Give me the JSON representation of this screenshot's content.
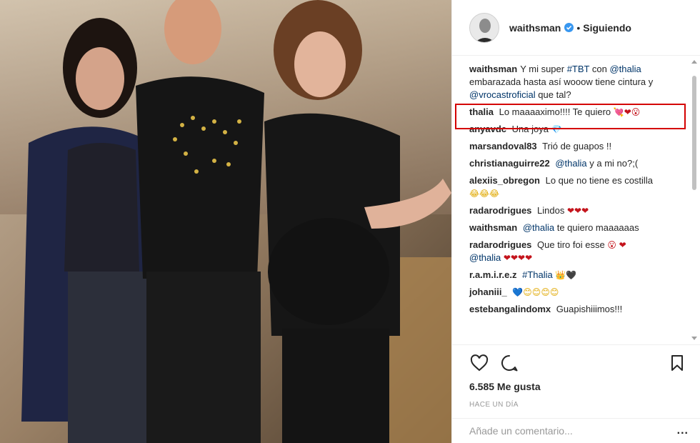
{
  "post": {
    "image_alt": "Photo of three people posing together",
    "author": "waithsman",
    "follow_status": "Siguiendo",
    "separator": "•"
  },
  "caption": {
    "user": "waithsman",
    "t1": "Y mi super ",
    "tag": "#TBT",
    "t2": " con ",
    "m1": "@thalia",
    "t3": " embarazada hasta así wooow tiene cintura y ",
    "m2": "@vrocastroficial",
    "t4": " que tal?"
  },
  "comments": [
    {
      "user": "thalia",
      "text": "Lo maaaaximo!!!! Te quiero",
      "emoji": "💘❤😮"
    },
    {
      "user": "anyavdc",
      "text": "Una joya",
      "emoji": "💎"
    },
    {
      "user": "marsandoval83",
      "text": "Trió de guapos !!",
      "emoji": ""
    },
    {
      "user": "christianaguirre22",
      "mention": "@thalia",
      "text": " y a mi no?;(",
      "emoji": ""
    },
    {
      "user": "alexiis_obregon",
      "text": "Lo que no tiene es costilla",
      "emoji": "😂😂😂"
    },
    {
      "user": "radarodrigues",
      "text": "Lindos",
      "emoji": "❤❤❤"
    },
    {
      "user": "waithsman",
      "mention": "@thalia",
      "text": " te quiero maaaaaas",
      "emoji": ""
    },
    {
      "user": "radarodrigues",
      "text": "Que tiro foi esse",
      "emoji": "😮 ❤",
      "mention2": "@thalia",
      "emoji2": "❤❤❤❤"
    },
    {
      "user": "r.a.m.i.r.e.z",
      "tag": "#Thalia",
      "emoji": "👑🖤"
    },
    {
      "user": "johaniii_",
      "emoji": "💙😊😊😊😊"
    },
    {
      "user": "estebangalindomx",
      "text": "Guapishiiimos!!!",
      "emoji": ""
    }
  ],
  "actions": {
    "like_icon": "heart-outline-icon",
    "comment_icon": "comment-bubble-icon",
    "save_icon": "bookmark-icon",
    "likes": "6.585 Me gusta",
    "timestamp": "HACE UN DÍA"
  },
  "add_comment": {
    "placeholder": "Añade un comentario...",
    "more": "..."
  },
  "colors": {
    "link": "#003569",
    "verified": "#3897f0",
    "highlight": "#d40000",
    "heart": "#c4141c"
  }
}
